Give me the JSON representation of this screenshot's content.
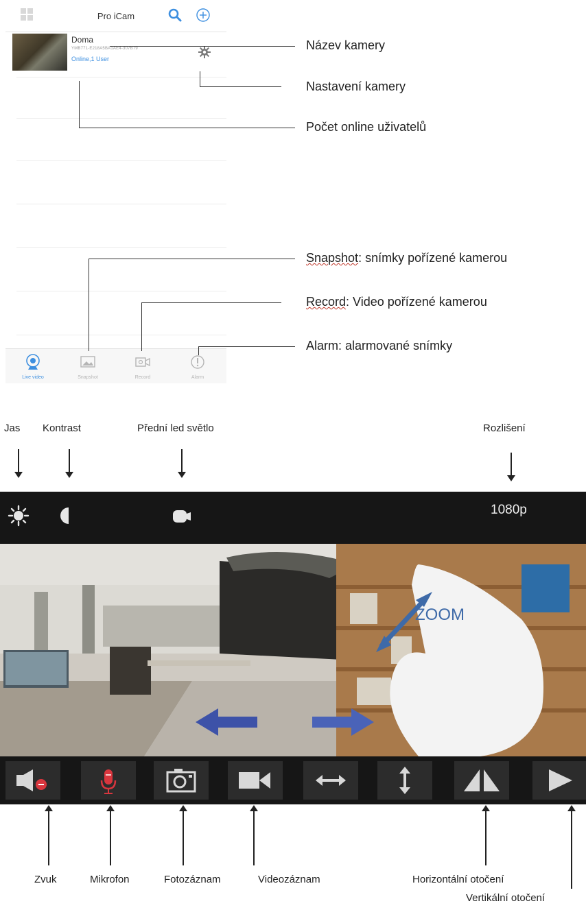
{
  "app": {
    "title": "Pro iCam",
    "camera": {
      "name": "Doma",
      "uid": "YMB771-E218A5BA1AE4-307B79",
      "status": "Online,1 User"
    },
    "tabs": [
      {
        "label": "Live video",
        "icon": "live-video-icon",
        "active": true
      },
      {
        "label": "Snapshot",
        "icon": "snapshot-icon",
        "active": false
      },
      {
        "label": "Record",
        "icon": "record-icon",
        "active": false
      },
      {
        "label": "Alarm",
        "icon": "alarm-icon",
        "active": false
      }
    ]
  },
  "callouts": {
    "camera_name": "Název kamery",
    "camera_settings": "Nastavení kamery",
    "online_users": "Počet online  uživatelů",
    "snapshot_term": "Snapshot",
    "snapshot_desc": ": snímky pořízené kamerou",
    "record_term": "Record",
    "record_desc": ": Video pořízené kamerou",
    "alarm": "Alarm: alarmované snímky"
  },
  "top_labels": {
    "jas": "Jas",
    "kontrast": "Kontrast",
    "led": "Přední led světlo",
    "rozliseni": "Rozlišení"
  },
  "viewer": {
    "resolution": "1080p",
    "zoom_text": "ZOOM"
  },
  "controls": [
    {
      "icon": "speaker-mute-icon"
    },
    {
      "icon": "microphone-icon"
    },
    {
      "icon": "camera-icon"
    },
    {
      "icon": "video-camera-icon"
    },
    {
      "icon": "horizontal-arrows-icon"
    },
    {
      "icon": "vertical-arrows-icon"
    },
    {
      "icon": "flip-horizontal-icon"
    },
    {
      "icon": "flip-vertical-icon"
    }
  ],
  "bottom_labels": {
    "zvuk": "Zvuk",
    "mikrofon": "Mikrofon",
    "fotozaznam": "Fotozáznam",
    "videozaznam": "Videozáznam",
    "horizontal": "Horizontální otočení",
    "vertical": "Vertikální otočení"
  },
  "colors": {
    "accent_blue": "#3d8fe0",
    "bar_dark": "#161616",
    "mic_red": "#d9363e"
  }
}
